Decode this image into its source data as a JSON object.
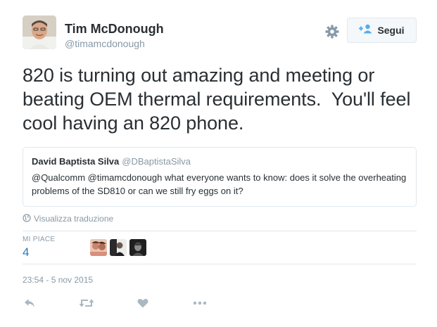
{
  "author": {
    "name": "Tim McDonough",
    "handle": "@timamcdonough",
    "follow_label": "Segui",
    "settings_icon": "gear-icon",
    "follow_icon": "add-user-icon"
  },
  "tweet": {
    "text": "820 is turning out amazing and meeting or beating OEM thermal requirements.  You'll feel cool having an 820 phone."
  },
  "quote": {
    "name": "David Baptista Silva",
    "handle": "@DBaptistaSilva",
    "text": "@Qualcomm @timamcdonough what everyone wants to know: does it solve the overheating problems of the SD810 or can we still fry eggs on it?"
  },
  "translate": {
    "label": "Visualizza traduzione",
    "icon": "globe-icon"
  },
  "likes": {
    "label": "MI PIACE",
    "count": "4"
  },
  "timestamp": "23:54 - 5 nov 2015",
  "actions": [
    "reply-icon",
    "retweet-icon",
    "like-icon",
    "more-icon"
  ],
  "colors": {
    "text": "#292f33",
    "muted": "#8899a6",
    "link": "#2b7bb9",
    "border": "#e1e8ed",
    "action_icon": "#aab8c2"
  }
}
